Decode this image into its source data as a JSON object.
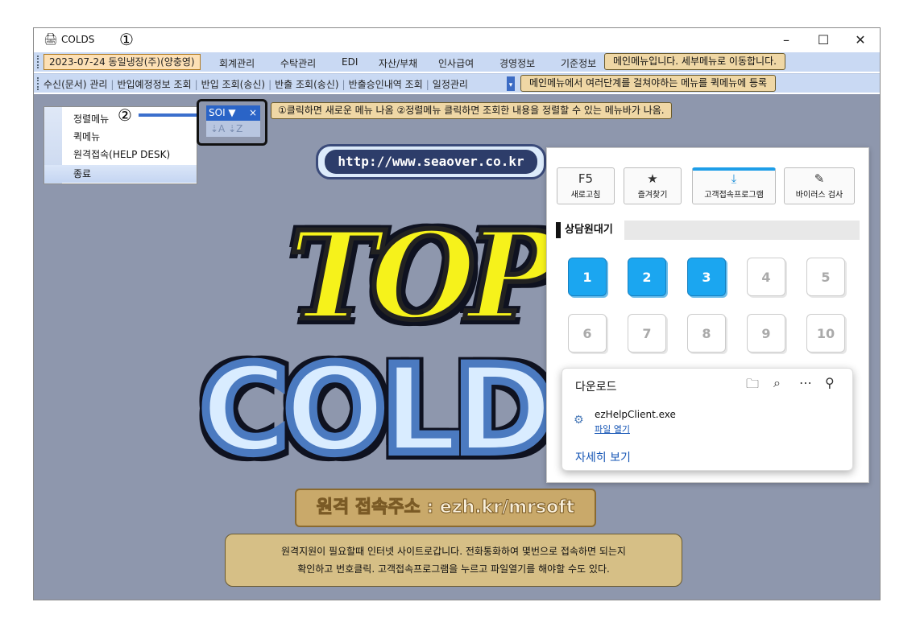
{
  "window": {
    "title": "COLDS",
    "annotation": "①",
    "controls": [
      "–",
      "☐",
      "✕"
    ]
  },
  "menubar": {
    "date_label": "2023-07-24 동일냉장(주)(양충영)",
    "items": [
      "회계관리",
      "수탁관리",
      "EDI",
      "자산/부채",
      "인사급여",
      "경영정보",
      "기준정보"
    ],
    "tooltip": "메인메뉴입니다. 세부메뉴로 이동합니다."
  },
  "quickbar": {
    "items": [
      "수신(문서) 관리",
      "반입예정정보 조회",
      "반입 조회(송신)",
      "반출 조회(송신)",
      "반출승인내역 조회",
      "일정관리"
    ],
    "tooltip": "메인메뉴에서 여러단계를 걸쳐야하는 메뉴를 퀵메뉴에 등록"
  },
  "context_menu": {
    "items": [
      "정렬메뉴",
      "퀵메뉴",
      "원격접속(HELP DESK)",
      "종료"
    ],
    "annotation": "②"
  },
  "sortbar": {
    "label": "SOI ▼",
    "close": "×",
    "icons": "⇣A ⇣Z"
  },
  "note_top": "①클릭하면 새로운 메뉴 나옴 ②정렬메뉴 클릭하면 조회한 내용을 정렬할 수 있는 메뉴바가 나옴.",
  "url": "http://www.seaover.co.kr",
  "logo": {
    "line1": "TOP",
    "line2": "COLD"
  },
  "remote_banner": "원격 접속주소 : ezh.kr/mrsoft",
  "bottom_note": {
    "line1": "원격지원이 필요할때 인터넷 사이트로갑니다. 전화통화하여 몇번으로 접속하면 되는지",
    "line2": "확인하고 번호클릭. 고객접속프로그램을 누르고 파일열기를 해야할 수도 있다."
  },
  "help_panel": {
    "buttons": [
      {
        "icon": "F5",
        "label": "새로고침"
      },
      {
        "icon": "★",
        "label": "즐겨찾기"
      },
      {
        "icon": "⤓",
        "label": "고객접속프로그램"
      },
      {
        "icon": "✎",
        "label": "바이러스 검사"
      }
    ],
    "wait_label": "상담원대기",
    "numbers": [
      "1",
      "2",
      "3",
      "4",
      "5",
      "6",
      "7",
      "8",
      "9",
      "10"
    ],
    "active_numbers": [
      1,
      2,
      3
    ],
    "accent_color": "#1ba6f0"
  },
  "downloads": {
    "title": "다운로드",
    "file_name": "ezHelpClient.exe",
    "open_link": "파일 열기",
    "more_link": "자세히 보기"
  }
}
